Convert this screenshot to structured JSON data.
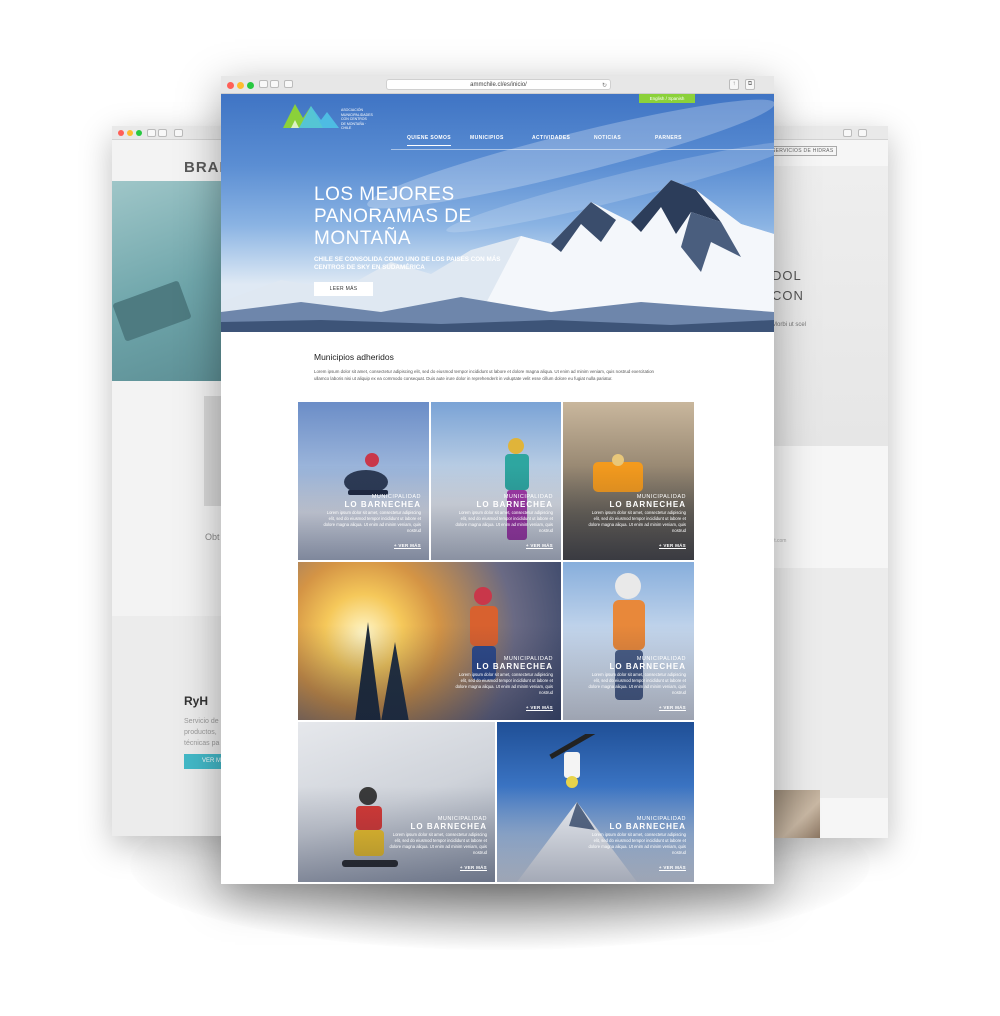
{
  "back_left": {
    "brand": "BRAND",
    "obt_text": "Obt",
    "section_title": "RyH",
    "description": "Servicio de productos, técnicas pa",
    "button_label": "VER M"
  },
  "back_right": {
    "nav_label": "SERVICIOS DE HIDRAS",
    "heading_line1": "DOL",
    "heading_line2": "CON",
    "body_text": "Morbi ut scel",
    "email_fragment": "ilt.com"
  },
  "browser": {
    "url": "ammchile.cl/es/inicio/"
  },
  "header": {
    "logo_text": "ASOCIACIÓN MUNICIPALIDADES CON CENTROS DE MONTAÑA · CHILE",
    "language_button": "English / Spanish",
    "nav": [
      {
        "label": "QUIENE SOMOS",
        "active": true
      },
      {
        "label": "MUNICIPIOS",
        "active": false
      },
      {
        "label": "ACTIVIDADES",
        "active": false
      },
      {
        "label": "NOTICIAS",
        "active": false
      },
      {
        "label": "PARNERS",
        "active": false
      }
    ]
  },
  "hero": {
    "title": "LOS MEJORES PANORAMAS DE MONTAÑA",
    "subtitle": "CHILE SE CONSOLIDA COMO UNO DE LOS PAISES CON MÁS CENTROS DE SKY EN SUDAMÉRICA",
    "button": "LEER MÁS"
  },
  "municipios": {
    "title": "Municipios adheridos",
    "text": "Lorem ipsum dolor sit amet, consectetur adipiscing elit, sed do eiusmod tempor incididunt ut labore et dolore magna aliqua. Ut enim ad minim veniam, quis nostrud exercitation ullamco laboris nisi ut aliquip ex ea commodo consequat. Duis aute irure dolor in reprehenderit in voluptate velit esse cillum dolore eu fugiat nulla pariatur."
  },
  "tiles": [
    {
      "muni": "MUNICIPALIDAD",
      "name": "LO BARNECHEA",
      "desc": "Lorem ipsum dolor sit amet, consectetur adipiscing elit, sed do eiusmod tempor incididunt ut labore et dolore magna aliqua. Ut enim ad minim veniam, quis nostrud",
      "more": "+ VER MÁS"
    },
    {
      "muni": "MUNICIPALIDAD",
      "name": "LO BARNECHEA",
      "desc": "Lorem ipsum dolor sit amet, consectetur adipiscing elit, sed do eiusmod tempor incididunt ut labore et dolore magna aliqua. Ut enim ad minim veniam, quis nostrud",
      "more": "+ VER MÁS"
    },
    {
      "muni": "MUNICIPALIDAD",
      "name": "LO BARNECHEA",
      "desc": "Lorem ipsum dolor sit amet, consectetur adipiscing elit, sed do eiusmod tempor incididunt ut labore et dolore magna aliqua. Ut enim ad minim veniam, quis nostrud",
      "more": "+ VER MÁS"
    },
    {
      "muni": "MUNICIPALIDAD",
      "name": "LO BARNECHEA",
      "desc": "Lorem ipsum dolor sit amet, consectetur adipiscing elit, sed do eiusmod tempor incididunt ut labore et dolore magna aliqua. Ut enim ad minim veniam, quis nostrud",
      "more": "+ VER MÁS"
    },
    {
      "muni": "MUNICIPALIDAD",
      "name": "LO BARNECHEA",
      "desc": "Lorem ipsum dolor sit amet, consectetur adipiscing elit, sed do eiusmod tempor incididunt ut labore et dolore magna aliqua. Ut enim ad minim veniam, quis nostrud",
      "more": "+ VER MÁS"
    },
    {
      "muni": "MUNICIPALIDAD",
      "name": "LO BARNECHEA",
      "desc": "Lorem ipsum dolor sit amet, consectetur adipiscing elit, sed do eiusmod tempor incididunt ut labore et dolore magna aliqua. Ut enim ad minim veniam, quis nostrud",
      "more": "+ VER MÁS"
    },
    {
      "muni": "MUNICIPALIDAD",
      "name": "LO BARNECHEA",
      "desc": "Lorem ipsum dolor sit amet, consectetur adipiscing elit, sed do eiusmod tempor incididunt ut labore et dolore magna aliqua. Ut enim ad minim veniam, quis nostrud",
      "more": "+ VER MÁS"
    }
  ],
  "colors": {
    "accent_green": "#8bd13a",
    "hero_blue": "#3f74c4",
    "left_button": "#43b9c8"
  }
}
